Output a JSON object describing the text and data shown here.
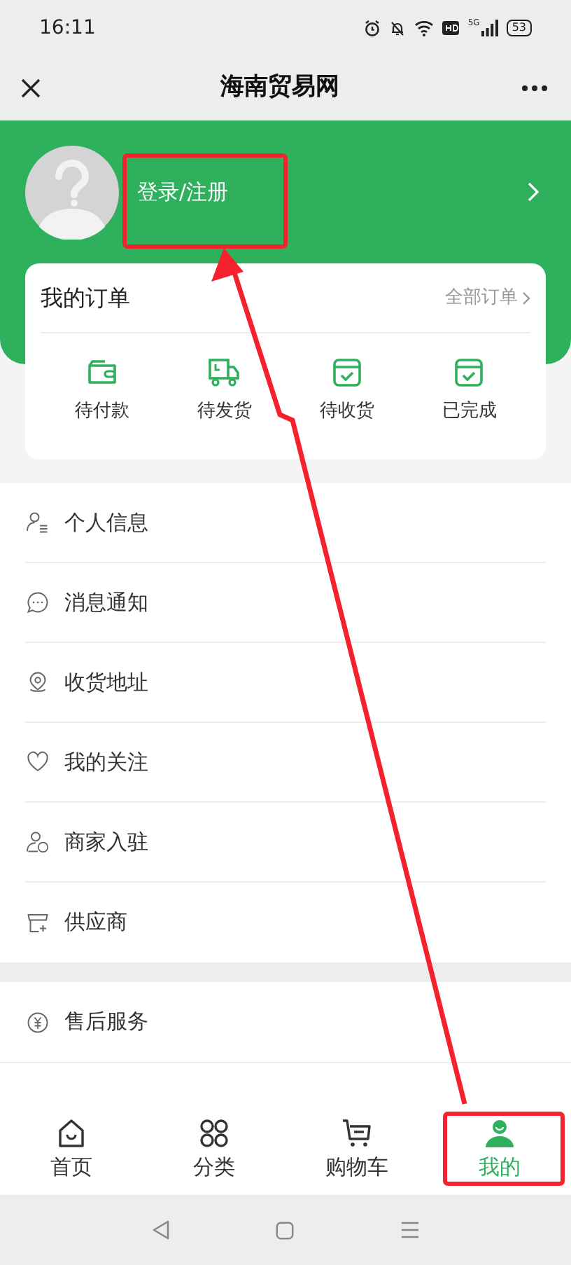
{
  "status_bar": {
    "time": "16:11",
    "battery": "53",
    "network": "5G"
  },
  "nav_bar": {
    "title": "海南贸易网"
  },
  "profile": {
    "login_label": "登录/注册"
  },
  "orders": {
    "title": "我的订单",
    "all_link": "全部订单",
    "items": [
      {
        "kind": "wallet",
        "label": "待付款"
      },
      {
        "kind": "truck",
        "label": "待发货"
      },
      {
        "kind": "box",
        "label": "待收货"
      },
      {
        "kind": "box",
        "label": "已完成"
      }
    ]
  },
  "menu_groups": [
    [
      {
        "kind": "person",
        "label": "个人信息"
      },
      {
        "kind": "chat",
        "label": "消息通知"
      },
      {
        "kind": "pin",
        "label": "收货地址"
      },
      {
        "kind": "heart",
        "label": "我的关注"
      },
      {
        "kind": "merchant",
        "label": "商家入驻"
      },
      {
        "kind": "store",
        "label": "供应商"
      }
    ],
    [
      {
        "kind": "yen",
        "label": "售后服务"
      }
    ]
  ],
  "tab_bar": [
    {
      "kind": "home",
      "label": "首页",
      "selected": false
    },
    {
      "kind": "grid",
      "label": "分类",
      "selected": false
    },
    {
      "kind": "cart",
      "label": "购物车",
      "selected": false
    },
    {
      "kind": "user",
      "label": "我的",
      "selected": true
    }
  ]
}
